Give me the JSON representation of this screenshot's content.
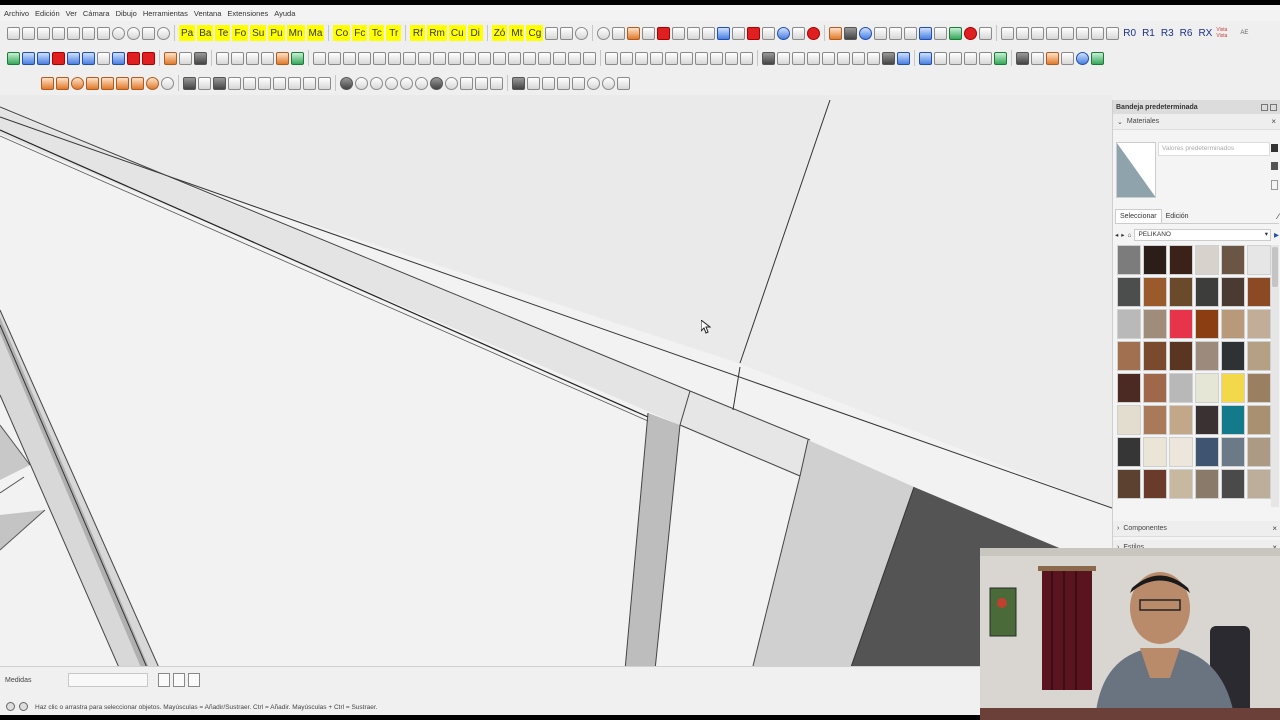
{
  "menu": [
    "Archivo",
    "Edición",
    "Ver",
    "Cámara",
    "Dibujo",
    "Herramientas",
    "Ventana",
    "Extensiones",
    "Ayuda"
  ],
  "toolbar1": {
    "yellow_buttons": [
      "Pa",
      "Ba",
      "Te",
      "Fo",
      "Su",
      "Pu",
      "Mn",
      "Ma",
      "Co",
      "Fc",
      "Tc",
      "Tr",
      "Rf",
      "Rm",
      "Cu",
      "Di",
      "Zó",
      "Mt",
      "Cg"
    ],
    "right_labels": [
      "R0",
      "R1",
      "R3",
      "R6",
      "RX"
    ],
    "tiny_labels": [
      "Vista Vista",
      "AE"
    ]
  },
  "tray": {
    "title": "Bandeja predeterminada",
    "materials_header": "Materiales",
    "material_name_placeholder": "Valores predeterminados",
    "tabs": [
      "Seleccionar",
      "Edición"
    ],
    "library": "PELIKANO",
    "components_header": "Componentes",
    "styles_header": "Estilos",
    "swatch_colors": [
      "#7c7c7c",
      "#2b1d18",
      "#3a2218",
      "#d7d2cc",
      "#6b5545",
      "#e6e6e6",
      "#4b4e4d",
      "#9a5a2c",
      "#6a4a2a",
      "#3d3d3b",
      "#4a3a32",
      "#8c4a24",
      "#b9b9b9",
      "#a08c7a",
      "#e8344a",
      "#8a3e12",
      "#b89a7a",
      "#c2ad98",
      "#a07050",
      "#7a4a2e",
      "#5a3622",
      "#9c8a7c",
      "#2f3235",
      "#b6a084",
      "#4a2a22",
      "#a0684a",
      "#b8b8b8",
      "#e6e6d6",
      "#f3d94a",
      "#9a8060",
      "#e3ddd0",
      "#a87a5a",
      "#c2a888",
      "#3a3232",
      "#127a8a",
      "#a89070",
      "#363636",
      "#ebe5d8",
      "#ece6dc",
      "#3e5470",
      "#6a7a86",
      "#ad9a84",
      "#5c4030",
      "#6a3a2a",
      "#c8b8a0",
      "#8a7a6a",
      "#4a4a4a",
      "#bcae9a"
    ]
  },
  "status": {
    "measure_label": "Medidas",
    "hint": "Haz clic o arrastra para seleccionar objetos. Mayúsculas = Añadir/Sustraer. Ctrl = Añadir. Mayúsculas + Ctrl = Sustraer."
  },
  "colors": {
    "canvas": "#ececec",
    "toolbar_yellow": "#ffff00",
    "face_gray": "#bdbdbd",
    "dark_face": "#545454"
  }
}
